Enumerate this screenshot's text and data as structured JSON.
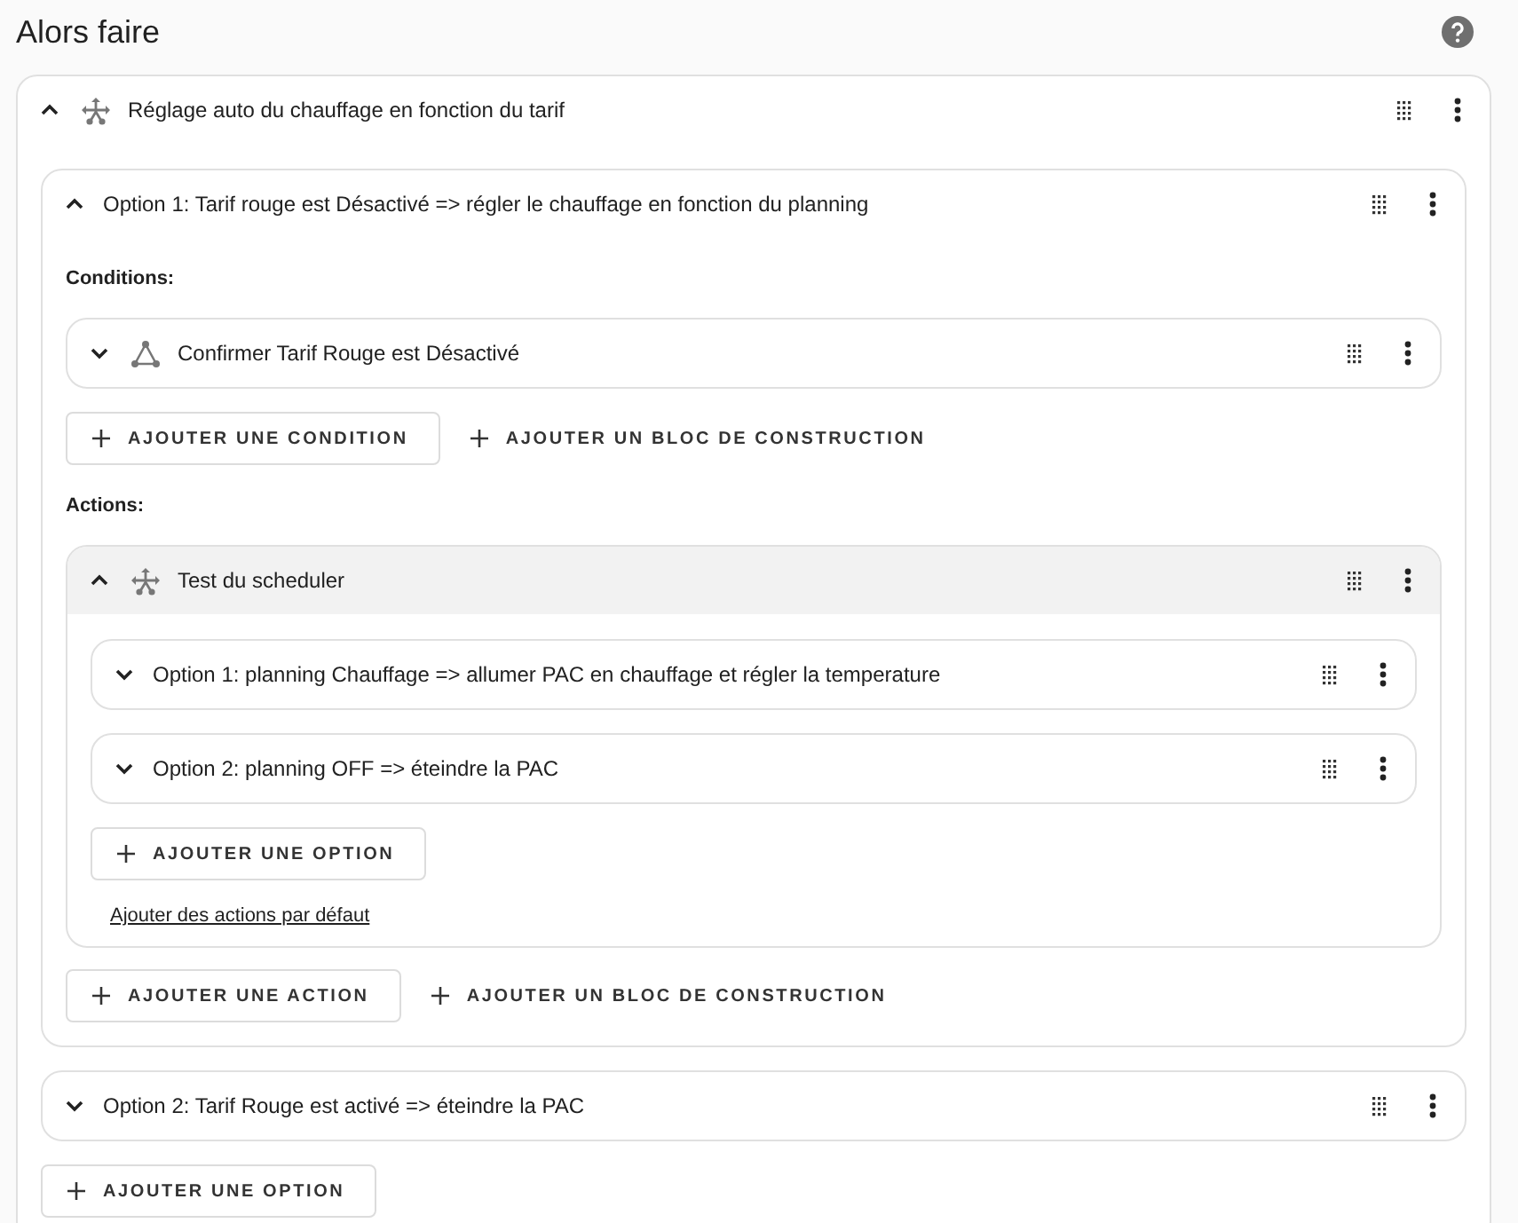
{
  "heading": "Alors faire",
  "blocks": [
    {
      "kind": "choose",
      "title": "Réglage auto du chauffage en fonction du tarif",
      "expanded": true,
      "highlighted": false,
      "options": [
        {
          "kind": "option",
          "title": "Option 1: Tarif rouge est Désactivé => régler le chauffage en fonction du planning",
          "expanded": true,
          "conditions_label": "Conditions:",
          "conditions": [
            {
              "kind": "condition",
              "title": "Confirmer Tarif Rouge est Désactivé",
              "expanded": false
            }
          ],
          "condition_buttons": [
            {
              "label": "AJOUTER UNE CONDITION",
              "kind": "outlined"
            },
            {
              "label": "AJOUTER UN BLOC DE CONSTRUCTION",
              "kind": "text"
            }
          ],
          "actions_label": "Actions:",
          "actions": [
            {
              "kind": "choose",
              "title": "Test du scheduler",
              "expanded": true,
              "highlighted": true,
              "options": [
                {
                  "kind": "option",
                  "title": "Option 1: planning Chauffage => allumer PAC en chauffage et régler la temperature",
                  "expanded": false
                },
                {
                  "kind": "option",
                  "title": "Option 2: planning OFF => éteindre la PAC",
                  "expanded": false
                }
              ],
              "add_option_button": {
                "label": "AJOUTER UNE OPTION",
                "kind": "outlined"
              },
              "default_actions_link": "Ajouter des actions par défaut"
            }
          ],
          "action_buttons": [
            {
              "label": "AJOUTER UNE ACTION",
              "kind": "outlined"
            },
            {
              "label": "AJOUTER UN BLOC DE CONSTRUCTION",
              "kind": "text"
            }
          ]
        },
        {
          "kind": "option",
          "title": "Option 2: Tarif Rouge est activé => éteindre la PAC",
          "expanded": false
        }
      ],
      "add_option_button": {
        "label": "AJOUTER UNE OPTION",
        "kind": "outlined"
      }
    }
  ]
}
